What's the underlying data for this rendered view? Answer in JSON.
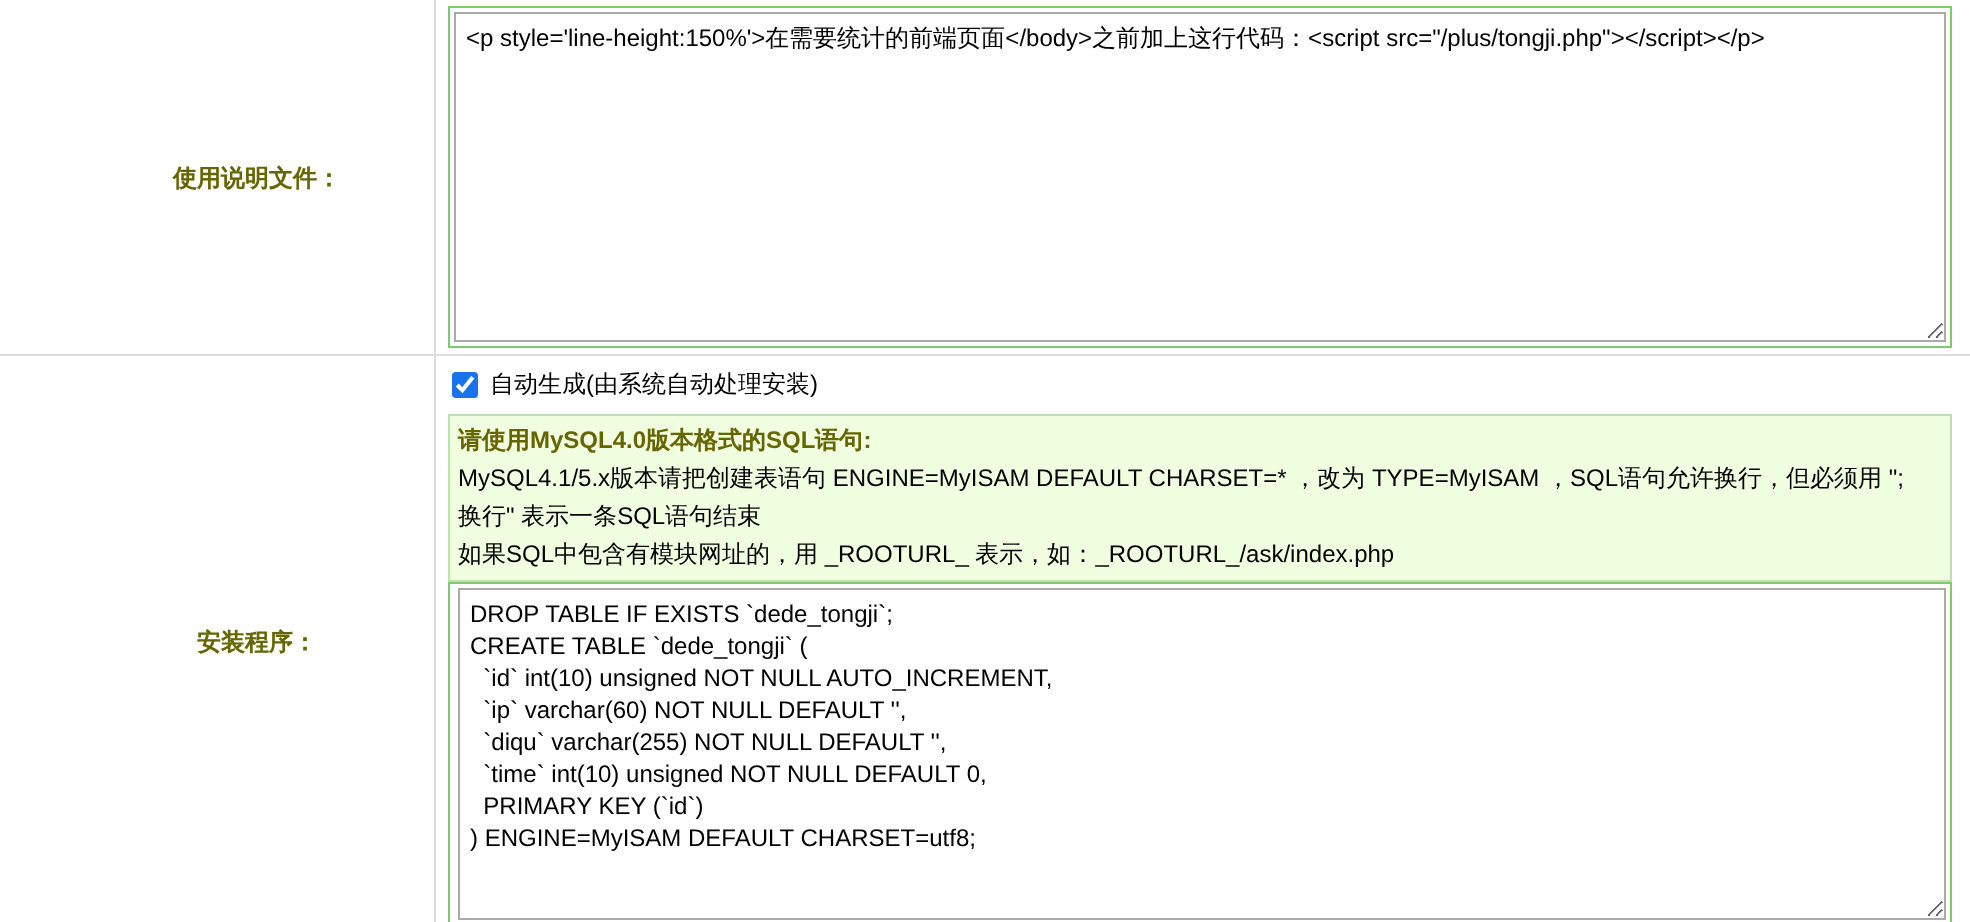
{
  "rows": [
    {
      "label": "使用说明文件：",
      "kind": "textarea",
      "value": "<p style='line-height:150%'>在需要统计的前端页面</body>之前加上这行代码：<script src=\"/plus/tongji.php\"></script></p>"
    },
    {
      "label": "安装程序：",
      "kind": "install",
      "checkbox": {
        "label": "自动生成(由系统自动处理安装)",
        "checked": true
      },
      "notice": {
        "title": "请使用MySQL4.0版本格式的SQL语句:",
        "lines": [
          "MySQL4.1/5.x版本请把创建表语句 ENGINE=MyISAM DEFAULT CHARSET=* ，改为 TYPE=MyISAM ，SQL语句允许换行，但必须用 \";",
          "换行\" 表示一条SQL语句结束",
          "如果SQL中包含有模块网址的，用 _ROOTURL_ 表示，如：_ROOTURL_/ask/index.php"
        ]
      },
      "value": "DROP TABLE IF EXISTS `dede_tongji`;\nCREATE TABLE `dede_tongji` (\n  `id` int(10) unsigned NOT NULL AUTO_INCREMENT,\n  `ip` varchar(60) NOT NULL DEFAULT '',\n  `diqu` varchar(255) NOT NULL DEFAULT '',\n  `time` int(10) unsigned NOT NULL DEFAULT 0,\n  PRIMARY KEY (`id`)\n) ENGINE=MyISAM DEFAULT CHARSET=utf8;"
    }
  ]
}
